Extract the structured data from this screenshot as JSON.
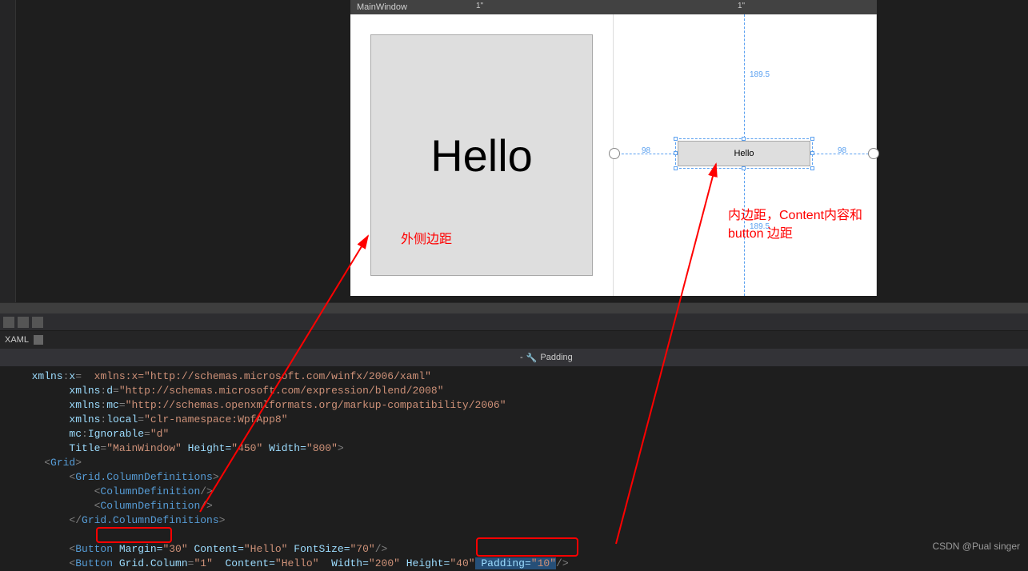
{
  "window": {
    "title": "MainWindow"
  },
  "ruler": {
    "m1": "1\"",
    "m2": "1\""
  },
  "designer": {
    "big_button_text": "Hello",
    "small_button_text": "Hello",
    "measure_top": "189.5",
    "measure_bottom": "189.5",
    "measure_left": "98",
    "measure_right": "98"
  },
  "annotations": {
    "left_label": "外侧边距",
    "right_label_line1": "内边距，Content内容和",
    "right_label_line2": "button 边距"
  },
  "file_tab": "XAML",
  "breadcrumb": {
    "property": "Padding"
  },
  "code": {
    "l0": "  xmlns:x=\"http://schemas.microsoft.com/winfx/2006/xaml\"",
    "l1": "        xmlns:d=\"http://schemas.microsoft.com/expression/blend/2008\"",
    "l2": "        xmlns:mc=\"http://schemas.openxmlformats.org/markup-compatibility/2006\"",
    "l3": "        xmlns:local=\"clr-namespace:WpfApp8\"",
    "l4": "        mc:Ignorable=\"d\"",
    "l5_a": "        Title=",
    "l5_b": "\"MainWindow\"",
    "l5_c": " Height=",
    "l5_d": "\"450\"",
    "l5_e": " Width=",
    "l5_f": "\"800\"",
    "l5_g": ">",
    "grid_open": "<Grid>",
    "gcd_open": "    <Grid.ColumnDefinitions>",
    "cd": "        <ColumnDefinition/>",
    "gcd_close": "    </Grid.ColumnDefinitions>",
    "btn1_a": "    <Button ",
    "btn1_margin_attr": "Margin=",
    "btn1_margin_val": "\"30\"",
    "btn1_b": " Content=",
    "btn1_c": "\"Hello\"",
    "btn1_d": " FontSize=",
    "btn1_e": "\"70\"",
    "btn1_f": "/>",
    "btn2_a": "    <Button Grid.Column=",
    "btn2_b": "\"1\"",
    "btn2_c": "  Content=",
    "btn2_d": "\"Hello\"",
    "btn2_e": "  Width=",
    "btn2_f": "\"200\"",
    "btn2_g": " Height=",
    "btn2_h": "\"40\"",
    "btn2_pad_attr": " Padding=",
    "btn2_pad_val": "\"10\"",
    "btn2_end": "/>"
  },
  "watermark": "CSDN @Pual singer"
}
